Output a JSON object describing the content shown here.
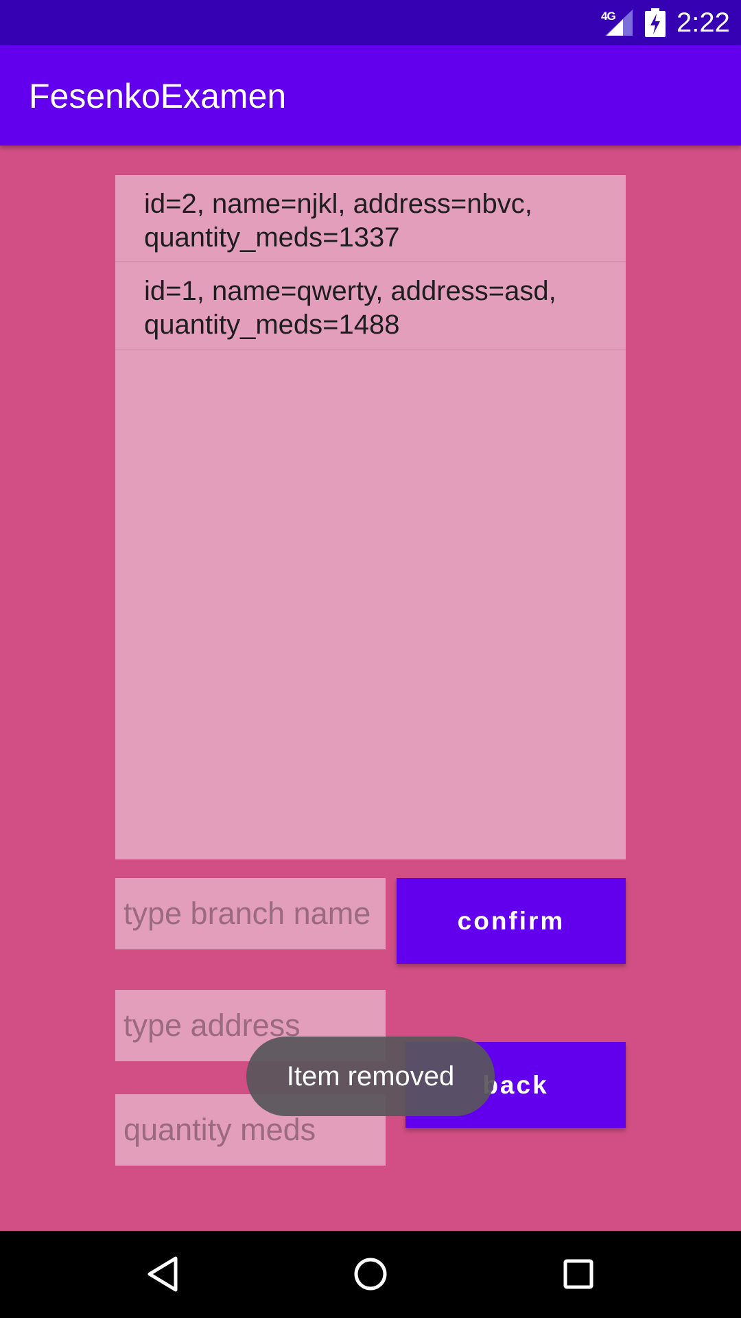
{
  "status_bar": {
    "network": "4G",
    "time": "2:22",
    "icons": [
      "signal-icon",
      "battery-charging-icon"
    ]
  },
  "app_bar": {
    "title": "FesenkoExamen"
  },
  "list": {
    "items": [
      {
        "line1": "id=2, name=njkl, address=nbvc,",
        "line2": "quantity_meds=1337"
      },
      {
        "line1": "id=1, name=qwerty, address=asd,",
        "line2": "quantity_meds=1488"
      }
    ]
  },
  "form": {
    "branch_name": {
      "value": "",
      "placeholder": "type branch name"
    },
    "address": {
      "value": "",
      "placeholder": "type address"
    },
    "quantity": {
      "value": "",
      "placeholder": "quantity meds"
    },
    "confirm_label": "confirm",
    "back_label": "back"
  },
  "toast": {
    "message": "Item removed"
  },
  "nav_bar": {
    "icons": [
      "back-icon",
      "home-icon",
      "recents-icon"
    ]
  },
  "colors": {
    "status_bar": "#3600b3",
    "app_bar": "#6200ee",
    "background": "#d14f84",
    "panel": "#e29eba",
    "button": "#6200ee"
  }
}
